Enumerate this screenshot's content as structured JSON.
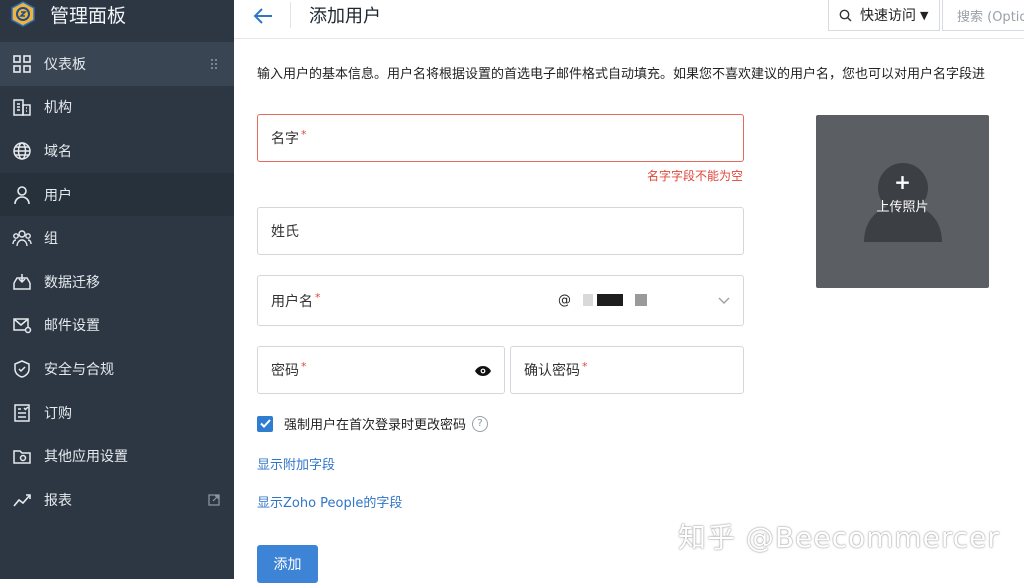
{
  "sidebar": {
    "title": "管理面板",
    "items": [
      {
        "label": "仪表板",
        "icon": "dashboard-icon"
      },
      {
        "label": "机构",
        "icon": "building-icon"
      },
      {
        "label": "域名",
        "icon": "globe-icon"
      },
      {
        "label": "用户",
        "icon": "user-icon"
      },
      {
        "label": "组",
        "icon": "group-icon"
      },
      {
        "label": "数据迁移",
        "icon": "migration-icon"
      },
      {
        "label": "邮件设置",
        "icon": "mail-settings-icon"
      },
      {
        "label": "安全与合规",
        "icon": "shield-icon"
      },
      {
        "label": "订购",
        "icon": "subscription-icon"
      },
      {
        "label": "其他应用设置",
        "icon": "app-settings-icon"
      },
      {
        "label": "报表",
        "icon": "chart-icon"
      }
    ]
  },
  "header": {
    "title": "添加用户",
    "quick_access": "快速访问",
    "search_placeholder": "搜索 (Optio"
  },
  "form": {
    "info": "输入用户的基本信息。用户名将根据设置的首选电子邮件格式自动填充。如果您不喜欢建议的用户名，您也可以对用户名字段进",
    "first_name_label": "名字",
    "first_name_error": "名字字段不能为空",
    "last_name_label": "姓氏",
    "username_label": "用户名",
    "domain_at": "@",
    "password_label": "密码",
    "confirm_password_label": "确认密码",
    "required_mark": "*",
    "force_change_label": "强制用户在首次登录时更改密码",
    "force_change_checked": true,
    "help_mark": "?",
    "show_extra_fields": "显示附加字段",
    "show_zoho_people_fields": "显示Zoho People的字段",
    "add_button": "添加",
    "upload_photo": "上传照片",
    "upload_plus": "+"
  },
  "watermark": "知乎 @Beecommercer",
  "colors": {
    "sidebar_bg": "#2d3743",
    "accent": "#3d84d6",
    "error": "#e0463a"
  }
}
